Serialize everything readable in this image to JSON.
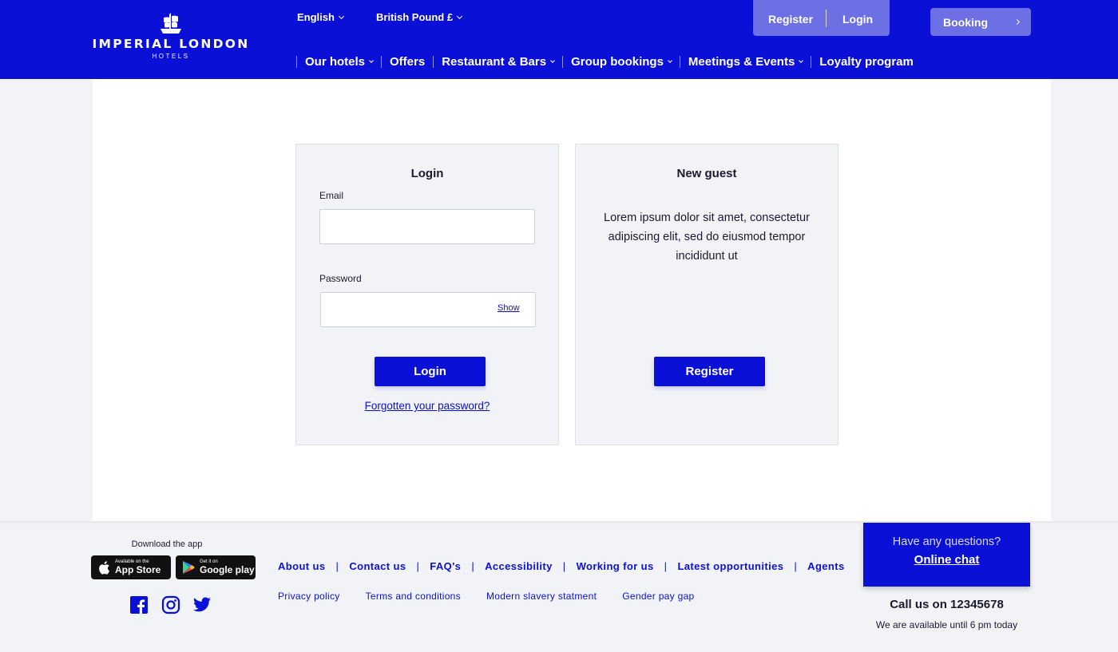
{
  "brand": {
    "name": "IMPERIAL LONDON",
    "sub": "HOTELS"
  },
  "header": {
    "language": "English",
    "currency": "British Pound £",
    "register": "Register",
    "login": "Login",
    "booking": "Booking"
  },
  "nav": {
    "items": [
      {
        "label": "Our hotels",
        "dropdown": true
      },
      {
        "label": "Offers",
        "dropdown": false
      },
      {
        "label": "Restaurant & Bars",
        "dropdown": true
      },
      {
        "label": "Group bookings",
        "dropdown": true
      },
      {
        "label": "Meetings & Events",
        "dropdown": true
      },
      {
        "label": "Loyalty program",
        "dropdown": false
      }
    ]
  },
  "login_card": {
    "title": "Login",
    "email_label": "Email",
    "email_value": "",
    "password_label": "Password",
    "password_value": "",
    "show": "Show",
    "button": "Login",
    "forgot": "Forgotten your password?"
  },
  "guest_card": {
    "title": "New guest",
    "text": "Lorem ipsum dolor sit amet, consectetur adipiscing elit, sed do eiusmod tempor incididunt ut",
    "button": "Register"
  },
  "footer": {
    "download_label": "Download the app",
    "app_store_small": "Available on the",
    "app_store_big": "App Store",
    "google_small": "Get it on",
    "google_big": "Google play",
    "links": [
      "About us",
      "Contact us",
      "FAQ's",
      "Accessibility",
      "Working for us",
      "Latest opportunities",
      "Agents"
    ],
    "legal": [
      "Privacy policy",
      "Terms and conditions",
      "Modern slavery statment",
      "Gender pay gap"
    ],
    "chat_question": "Have any questions?",
    "chat_link": "Online chat",
    "call": "Call us on 12345678",
    "availability": "We are available until 6 pm today"
  },
  "colors": {
    "brand_blue": "#0a10d6",
    "accent_purple": "#6c70e4",
    "background": "#f2f3f7"
  }
}
